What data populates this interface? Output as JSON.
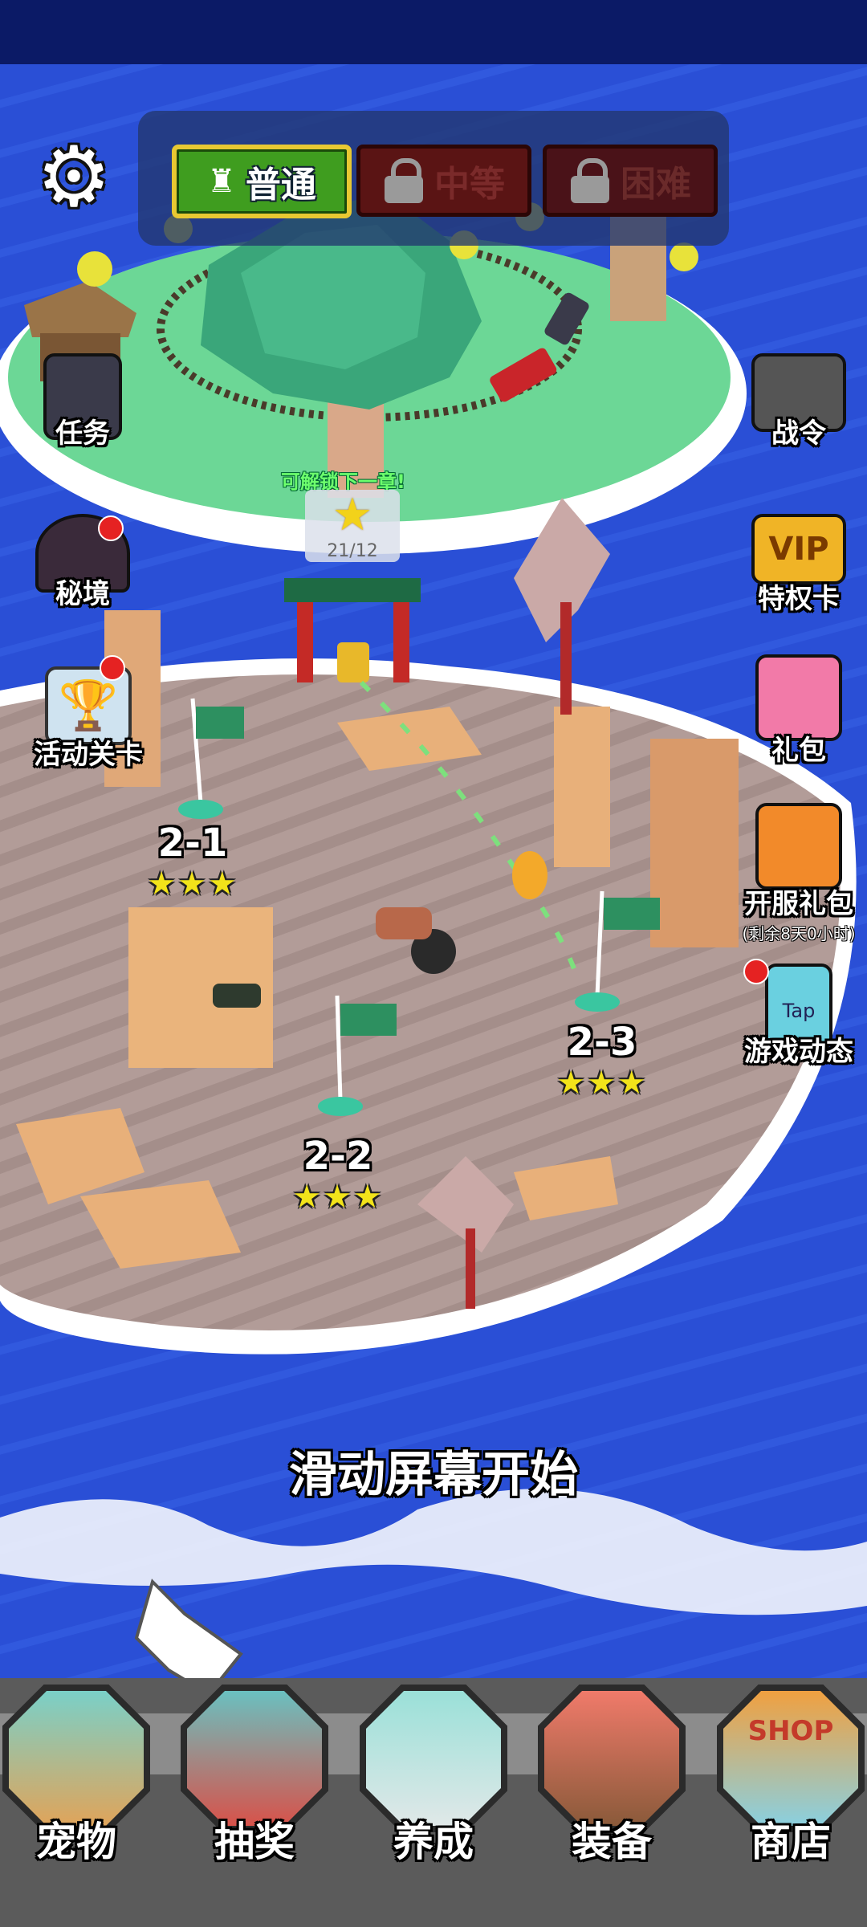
{
  "difficulty_tabs": [
    {
      "label": "普通",
      "state": "selected"
    },
    {
      "label": "中等",
      "state": "locked"
    },
    {
      "label": "困难",
      "state": "locked"
    }
  ],
  "settings_icon": "gear-icon",
  "left_menu": [
    {
      "label": "任务",
      "icon": "book-icon",
      "badge": false
    },
    {
      "label": "秘境",
      "icon": "cave-icon",
      "badge": true
    },
    {
      "label": "活动关卡",
      "icon": "trophy-icon",
      "badge": true
    }
  ],
  "right_menu": [
    {
      "label": "战令",
      "icon": "tv-icon",
      "badge": false
    },
    {
      "label": "特权卡",
      "icon": "vip-icon",
      "badge": false,
      "icon_text": "VIP"
    },
    {
      "label": "礼包",
      "icon": "gift-icon",
      "badge": false
    },
    {
      "label": "开服礼包",
      "sub": "(剩余8天0小时)",
      "icon": "character-icon",
      "badge": false
    },
    {
      "label": "游戏动态",
      "icon": "phone-icon",
      "badge": true,
      "icon_text": "Tap"
    }
  ],
  "unlock": {
    "hint": "可解锁下一章!",
    "star_count": "21/12"
  },
  "stages": [
    {
      "label": "2-1",
      "stars": "★★★"
    },
    {
      "label": "2-2",
      "stars": "★★★"
    },
    {
      "label": "2-3",
      "stars": "★★★"
    }
  ],
  "swipe_hint": "滑动屏幕开始",
  "bottom_nav": [
    {
      "label": "宠物",
      "icon": "egg-icon"
    },
    {
      "label": "抽奖",
      "icon": "mystery-box-icon"
    },
    {
      "label": "养成",
      "icon": "bottle-icon"
    },
    {
      "label": "装备",
      "icon": "sword-icon"
    },
    {
      "label": "商店",
      "icon": "shop-icon",
      "icon_text": "SHOP"
    }
  ],
  "colors": {
    "sea": "#2a4fd6",
    "grass": "#6cd796",
    "sand": "#b09a94",
    "selected_tab": "#3f9d1f",
    "star": "#f2e31a"
  }
}
